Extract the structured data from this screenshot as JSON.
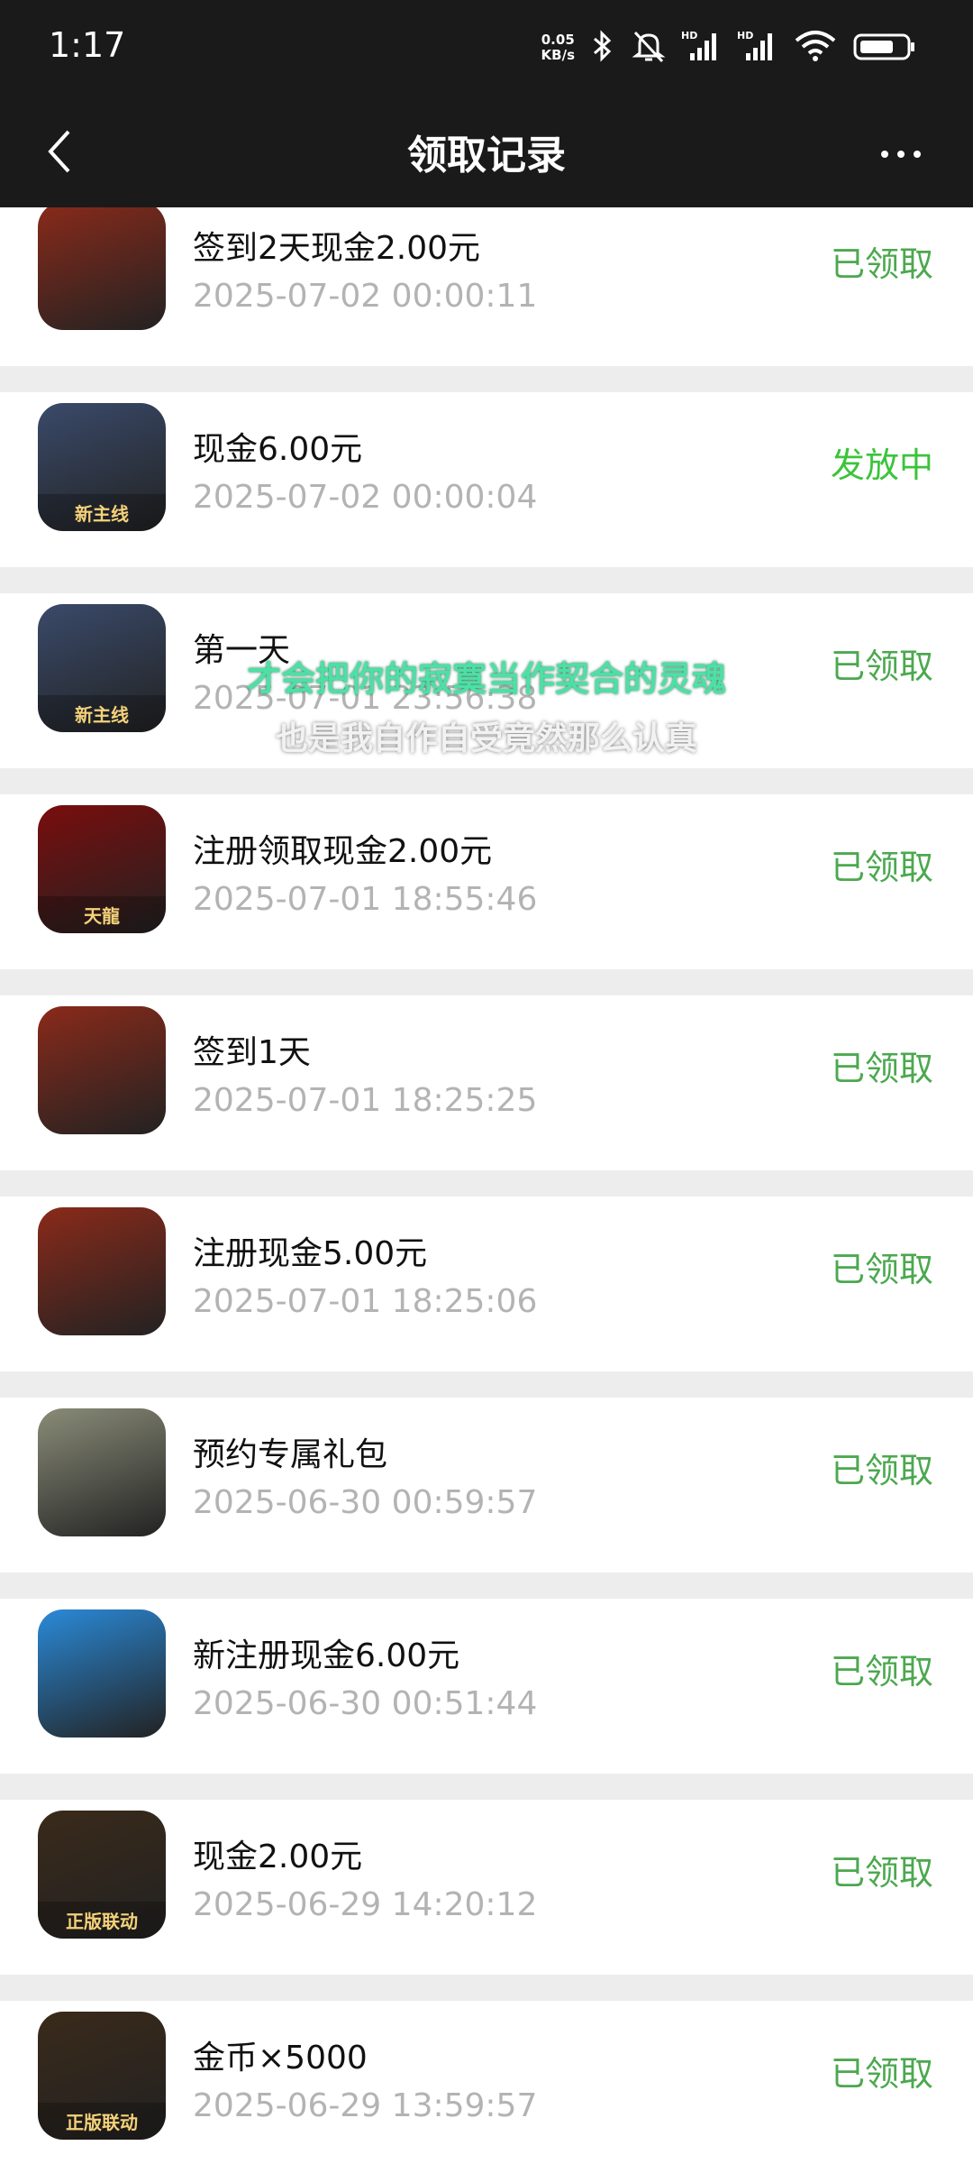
{
  "status_bar": {
    "time": "1:17",
    "net_speed_value": "0.05",
    "net_speed_unit": "KB/s",
    "icons": [
      "bluetooth-icon",
      "mute-icon",
      "signal-hd-icon",
      "signal-hd-icon",
      "wifi-icon",
      "battery-icon"
    ]
  },
  "nav": {
    "title": "领取记录",
    "back_icon": "chevron-left-icon",
    "more_icon": "more-icon"
  },
  "records": [
    {
      "title": "签到2天现金2.00元",
      "date": "2025-07-02 00:00:11",
      "status": "已领取",
      "icon_color": "#8a2a1a",
      "icon_label": ""
    },
    {
      "title": "现金6.00元",
      "date": "2025-07-02 00:00:04",
      "status": "发放中",
      "icon_color": "#3a4a6a",
      "icon_label": "新主线"
    },
    {
      "title": "第一天",
      "date": "2025-07-01 23:56:38",
      "status": "已领取",
      "icon_color": "#3a4a6a",
      "icon_label": "新主线"
    },
    {
      "title": "注册领取现金2.00元",
      "date": "2025-07-01 18:55:46",
      "status": "已领取",
      "icon_color": "#7a0d0d",
      "icon_label": "天龍"
    },
    {
      "title": "签到1天",
      "date": "2025-07-01 18:25:25",
      "status": "已领取",
      "icon_color": "#8a2a1a",
      "icon_label": ""
    },
    {
      "title": "注册现金5.00元",
      "date": "2025-07-01 18:25:06",
      "status": "已领取",
      "icon_color": "#8a2a1a",
      "icon_label": ""
    },
    {
      "title": "预约专属礼包",
      "date": "2025-06-30 00:59:57",
      "status": "已领取",
      "icon_color": "#8a8c78",
      "icon_label": ""
    },
    {
      "title": "新注册现金6.00元",
      "date": "2025-06-30 00:51:44",
      "status": "已领取",
      "icon_color": "#2a8ad8",
      "icon_label": ""
    },
    {
      "title": "现金2.00元",
      "date": "2025-06-29 14:20:12",
      "status": "已领取",
      "icon_color": "#3a2a1a",
      "icon_label": "正版联动"
    },
    {
      "title": "金币×5000",
      "date": "2025-06-29 13:59:57",
      "status": "已领取",
      "icon_color": "#3a2a1a",
      "icon_label": "正版联动"
    }
  ],
  "overlay_subtitles": [
    "才会把你的寂寞当作契合的灵魂",
    "也是我自作自受竟然那么认真"
  ]
}
